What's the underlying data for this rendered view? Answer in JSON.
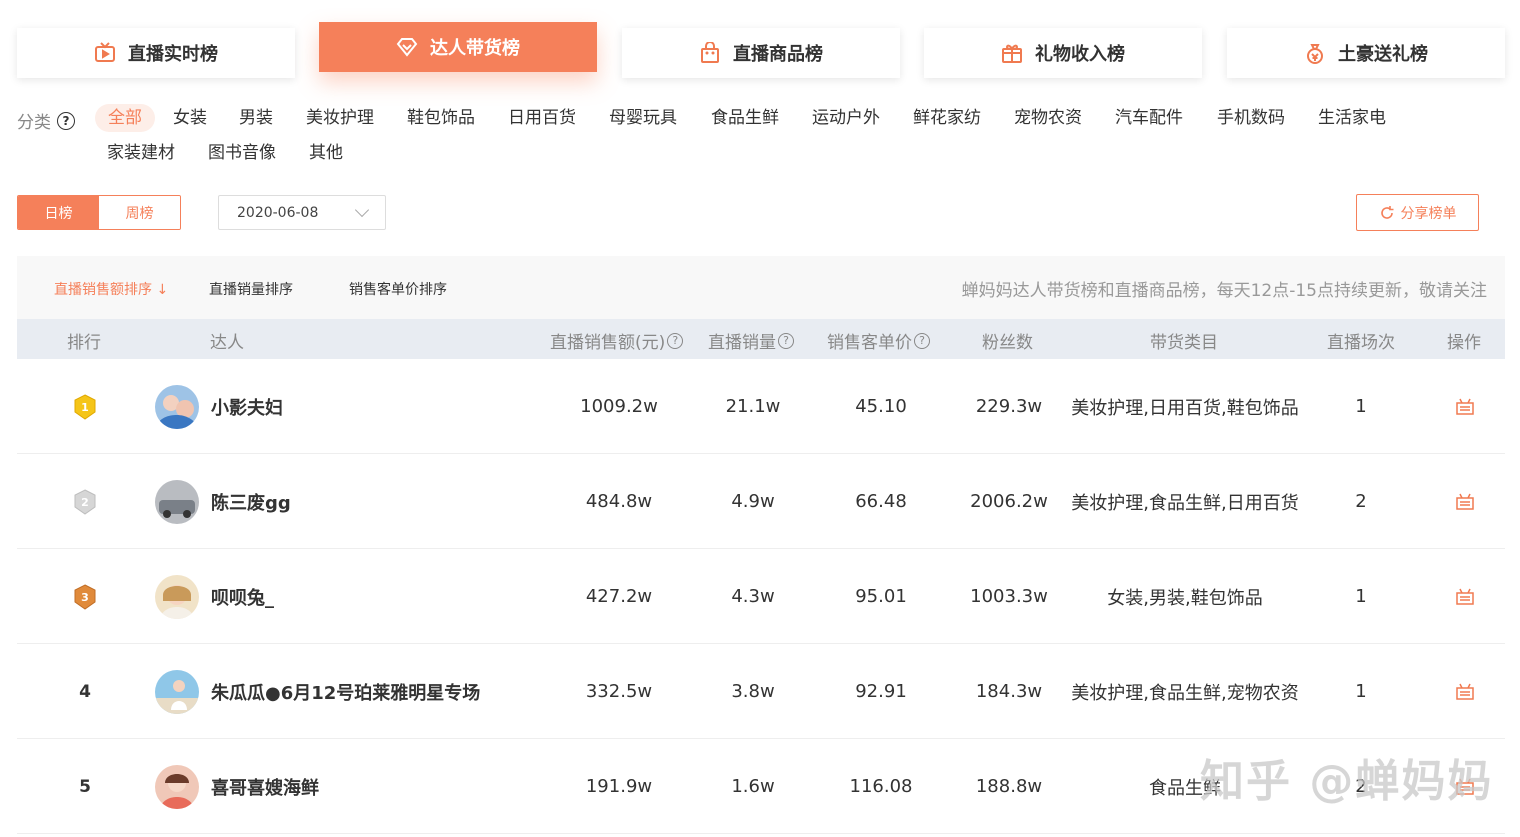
{
  "tabs": [
    {
      "label": "直播实时榜",
      "icon": "tv-icon",
      "active": false
    },
    {
      "label": "达人带货榜",
      "icon": "diamond-icon",
      "active": true
    },
    {
      "label": "直播商品榜",
      "icon": "bag-icon",
      "active": false
    },
    {
      "label": "礼物收入榜",
      "icon": "gift-icon",
      "active": false
    },
    {
      "label": "土豪送礼榜",
      "icon": "moneybag-icon",
      "active": false
    }
  ],
  "category": {
    "label": "分类",
    "items": [
      "全部",
      "女装",
      "男装",
      "美妆护理",
      "鞋包饰品",
      "日用百货",
      "母婴玩具",
      "食品生鲜",
      "运动户外",
      "鲜花家纺",
      "宠物农资",
      "汽车配件",
      "手机数码",
      "生活家电",
      "家装建材",
      "图书音像",
      "其他"
    ],
    "active": "全部"
  },
  "period": {
    "daily": "日榜",
    "weekly": "周榜",
    "active": "日榜"
  },
  "date": "2020-06-08",
  "share_label": "分享榜单",
  "sorts": [
    "直播销售额排序",
    "直播销量排序",
    "销售客单价排序"
  ],
  "note": "蝉妈妈达人带货榜和直播商品榜，每天12点-15点持续更新，敬请关注",
  "columns": {
    "rank": "排行",
    "talent": "达人",
    "sales": "直播销售额(元)",
    "volume": "直播销量",
    "price": "销售客单价",
    "fans": "粉丝数",
    "categories": "带货类目",
    "sessions": "直播场次",
    "op": "操作"
  },
  "rows": [
    {
      "rank": "1",
      "name": "小影夫妇",
      "sales": "1009.2w",
      "volume": "21.1w",
      "price": "45.10",
      "fans": "229.3w",
      "categories": "美妆护理,日用百货,鞋包饰品",
      "sessions": "1"
    },
    {
      "rank": "2",
      "name": "陈三废gg",
      "sales": "484.8w",
      "volume": "4.9w",
      "price": "66.48",
      "fans": "2006.2w",
      "categories": "美妆护理,食品生鲜,日用百货",
      "sessions": "2"
    },
    {
      "rank": "3",
      "name": "呗呗兔_",
      "sales": "427.2w",
      "volume": "4.3w",
      "price": "95.01",
      "fans": "1003.3w",
      "categories": "女装,男装,鞋包饰品",
      "sessions": "1"
    },
    {
      "rank": "4",
      "name": "朱瓜瓜●6月12号珀莱雅明星专场",
      "sales": "332.5w",
      "volume": "3.8w",
      "price": "92.91",
      "fans": "184.3w",
      "categories": "美妆护理,食品生鲜,宠物农资",
      "sessions": "1"
    },
    {
      "rank": "5",
      "name": "喜哥喜嫂海鲜",
      "sales": "191.9w",
      "volume": "1.6w",
      "price": "116.08",
      "fans": "188.8w",
      "categories": "食品生鲜",
      "sessions": "2"
    }
  ],
  "colors": {
    "accent": "#f5805a",
    "gold": "#f5c518",
    "silver": "#c8c8c8",
    "bronze": "#e08a3a"
  },
  "watermark": "知乎 @蝉妈妈"
}
